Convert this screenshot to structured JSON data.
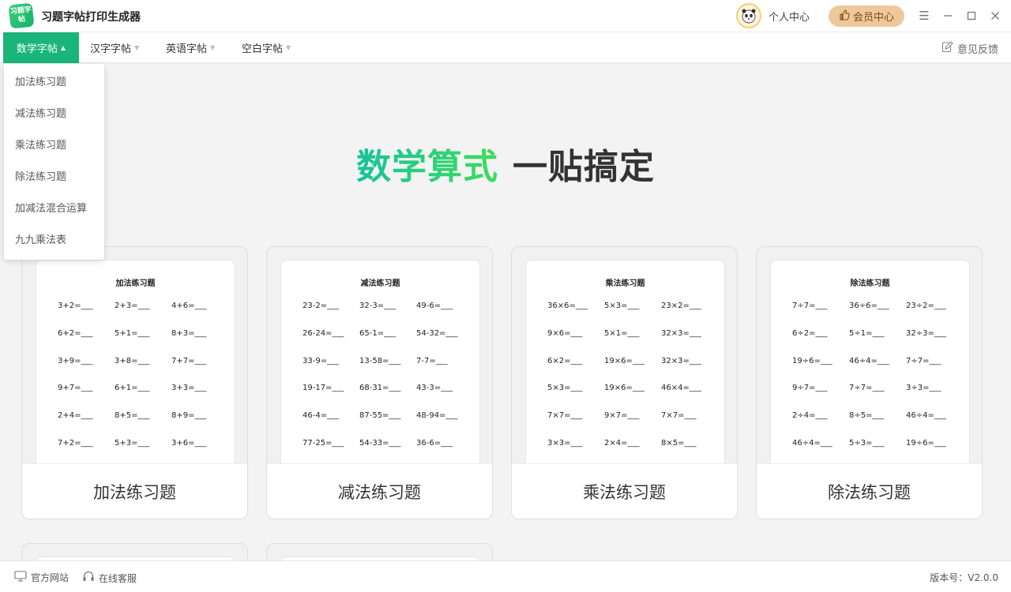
{
  "app": {
    "title": "习题字帖打印生成器",
    "logo_text": "习题字帖"
  },
  "header": {
    "personal_center": "个人中心",
    "vip_center": "会员中心"
  },
  "menu": {
    "tabs": [
      {
        "label": "数学字帖"
      },
      {
        "label": "汉字字帖"
      },
      {
        "label": "英语字帖"
      },
      {
        "label": "空白字帖"
      }
    ],
    "feedback": "意见反馈",
    "dropdown": [
      "加法练习题",
      "减法练习题",
      "乘法练习题",
      "除法练习题",
      "加减法混合运算",
      "九九乘法表"
    ]
  },
  "hero": {
    "highlight": "数学算式",
    "rest": "一贴搞定"
  },
  "cards": [
    {
      "sheet_title": "加法练习题",
      "label": "加法练习题",
      "problems": [
        "3+2=___",
        "2+3=___",
        "4+6=___",
        "6+2=___",
        "5+1=___",
        "8+3=___",
        "3+9=___",
        "3+8=___",
        "7+7=___",
        "9+7=___",
        "6+1=___",
        "3+3=___",
        "2+4=___",
        "8+5=___",
        "8+9=___",
        "7+2=___",
        "5+3=___",
        "3+6=___"
      ]
    },
    {
      "sheet_title": "减法练习题",
      "label": "减法练习题",
      "problems": [
        "23-2=___",
        "32-3=___",
        "49-6=___",
        "26-24=___",
        "65-1=___",
        "54-32=___",
        "33-9=___",
        "13-58=___",
        "7-7=___",
        "19-17=___",
        "68-31=___",
        "43-3=___",
        "46-4=___",
        "87-55=___",
        "48-94=___",
        "77-25=___",
        "54-33=___",
        "36-6=___"
      ]
    },
    {
      "sheet_title": "乘法练习题",
      "label": "乘法练习题",
      "problems": [
        "36×6=___",
        "5×3=___",
        "23×2=___",
        "9×6=___",
        "5×1=___",
        "32×3=___",
        "6×2=___",
        "19×6=___",
        "32×3=___",
        "5×3=___",
        "19×6=___",
        "46×4=___",
        "7×7=___",
        "9×7=___",
        "7×7=___",
        "3×3=___",
        "2×4=___",
        "8×5=___"
      ]
    },
    {
      "sheet_title": "除法练习题",
      "label": "除法练习题",
      "problems": [
        "7÷7=___",
        "36÷6=___",
        "23÷2=___",
        "6÷2=___",
        "5÷1=___",
        "32÷3=___",
        "19÷6=___",
        "46÷4=___",
        "7÷7=___",
        "9÷7=___",
        "7÷7=___",
        "3÷3=___",
        "2÷4=___",
        "8÷5=___",
        "46÷4=___",
        "46÷4=___",
        "5÷3=___",
        "19÷6=___"
      ]
    }
  ],
  "statusbar": {
    "official_site": "官方网站",
    "online_service": "在线客服",
    "version": "版本号：V2.0.0"
  },
  "colors": {
    "accent": "#19b57a",
    "vip": "#efc89a"
  }
}
